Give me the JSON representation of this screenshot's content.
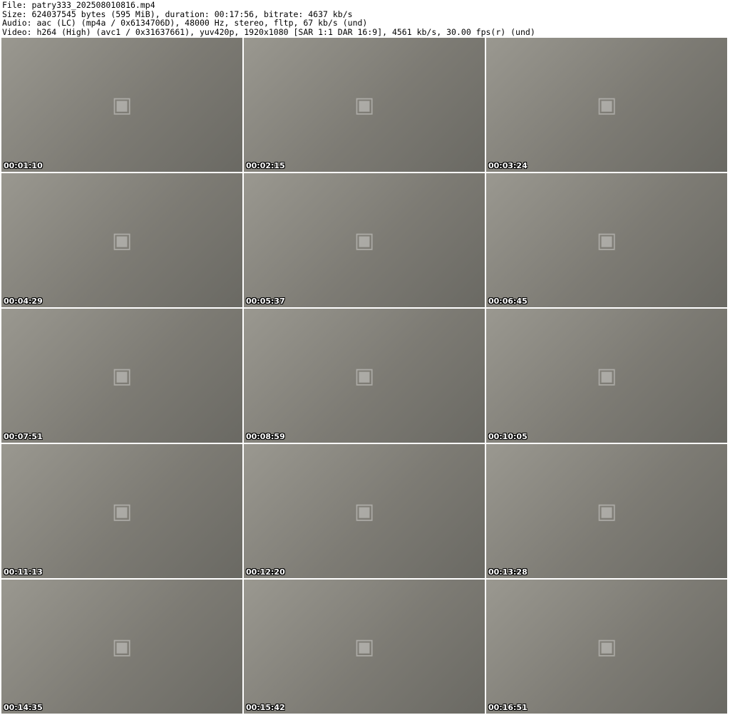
{
  "header": {
    "file": "File: patry333_202508010816.mp4",
    "size": "Size: 624037545 bytes (595 MiB), duration: 00:17:56, bitrate: 4637 kb/s",
    "audio": "Audio: aac (LC) (mp4a / 0x6134706D), 48000 Hz, stereo, fltp, 67 kb/s (und)",
    "video": "Video: h264 (High) (avc1 / 0x31637661), yuv420p, 1920x1080 [SAR 1:1 DAR 16:9], 4561 kb/s, 30.00 fps(r) (und)"
  },
  "thumbnails": [
    {
      "timestamp": "00:01:10"
    },
    {
      "timestamp": "00:02:15"
    },
    {
      "timestamp": "00:03:24"
    },
    {
      "timestamp": "00:04:29"
    },
    {
      "timestamp": "00:05:37"
    },
    {
      "timestamp": "00:06:45"
    },
    {
      "timestamp": "00:07:51"
    },
    {
      "timestamp": "00:08:59"
    },
    {
      "timestamp": "00:10:05"
    },
    {
      "timestamp": "00:11:13"
    },
    {
      "timestamp": "00:12:20"
    },
    {
      "timestamp": "00:13:28"
    },
    {
      "timestamp": "00:14:35"
    },
    {
      "timestamp": "00:15:42"
    },
    {
      "timestamp": "00:16:51"
    }
  ]
}
